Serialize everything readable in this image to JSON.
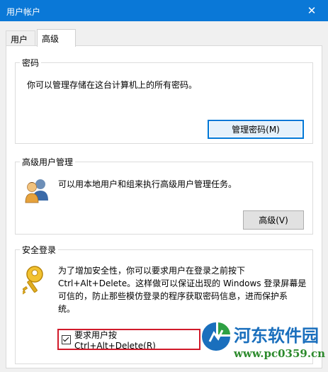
{
  "window": {
    "title": "用户帐户",
    "close_glyph": "✕"
  },
  "tabs": [
    {
      "label": "用户",
      "selected": false
    },
    {
      "label": "高级",
      "selected": true
    }
  ],
  "password_group": {
    "legend": "密码",
    "description": "你可以管理存储在这台计算机上的所有密码。",
    "button_label": "管理密码(M)"
  },
  "advanced_user_group": {
    "legend": "高级用户管理",
    "description": "可以用本地用户和组来执行高级用户管理任务。",
    "button_label": "高级(V)",
    "icon": "users-icon"
  },
  "secure_logon_group": {
    "legend": "安全登录",
    "description_lines": [
      "为了增加安全性，你可以要求用户在登录之前按下",
      "Ctrl+Alt+Delete。这样做可以保证出现的 Windows 登录屏幕是",
      "可信的，防止那些模仿登录的程序获取密码信息，进而保护系",
      "统。"
    ],
    "checkbox_label": "要求用户按 Ctrl+Alt+Delete(R)",
    "checkbox_checked": true,
    "icon": "key-icon"
  },
  "watermark": {
    "name": "河东软件园",
    "url": "www.pc0359.cn"
  },
  "colors": {
    "titlebar": "#0a78d7",
    "highlight": "#d11a2a",
    "default_button_border": "#0078d7"
  }
}
